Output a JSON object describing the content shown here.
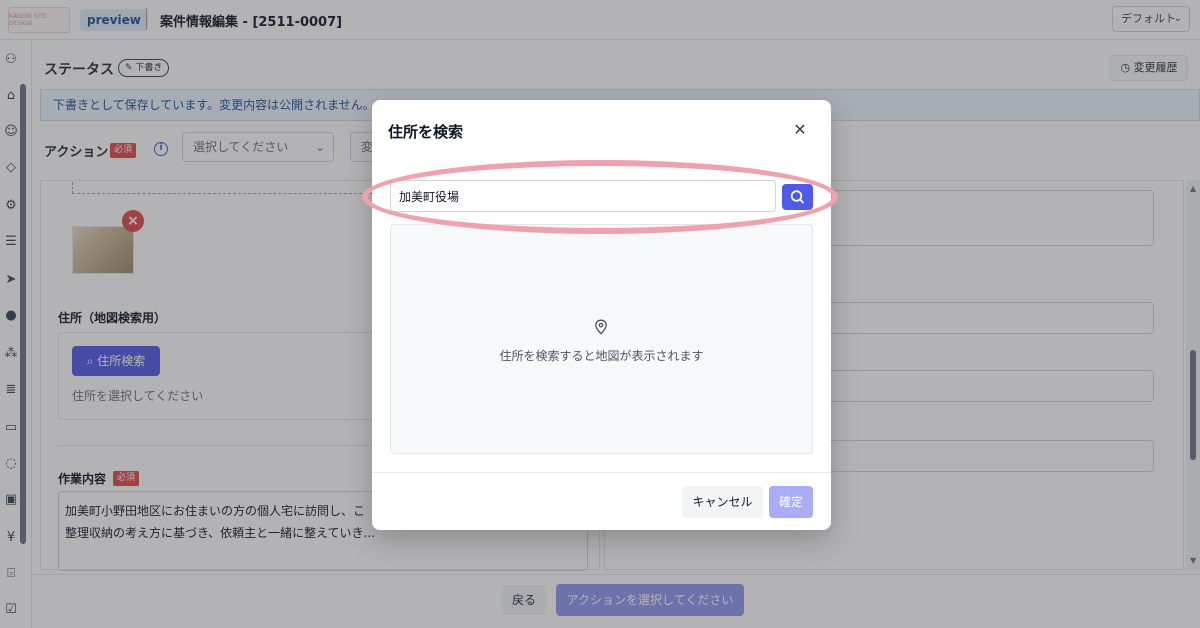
{
  "app": {
    "logo_text": "KAGOKI SITE DESIGN",
    "env_badge": "preview",
    "page_title": "案件情報編集 - [2511-0007]",
    "view_select": "デフォルト"
  },
  "status": {
    "title": "ステータス",
    "draft_label": "下書き",
    "history_button": "変更履歴",
    "notice": "下書きとして保存しています。変更内容は公開されません。"
  },
  "action": {
    "label": "アクション",
    "required": "必須",
    "select_placeholder": "選択してください",
    "select2_partial": "変"
  },
  "address": {
    "label": "住所（地図検索用）",
    "search_button": "住所検索",
    "placeholder": "住所を選択してください"
  },
  "work": {
    "label": "作業内容",
    "required": "必須",
    "line1": "加美町小野田地区にお住まいの方の個人宅に訪問し、こ",
    "line2": "整理収納の考え方に基づき、依頼主と一緒に整えていき..."
  },
  "footer": {
    "back_button": "戻る",
    "primary_button": "アクションを選択してください"
  },
  "modal": {
    "title": "住所を検索",
    "search_value": "加美町役場",
    "map_message": "住所を検索すると地図が表示されます",
    "cancel_button": "キャンセル",
    "confirm_button": "確定"
  },
  "colors": {
    "primary": "#4f5ae6",
    "required_red": "#e0484a",
    "highlight": "#eea2ae"
  },
  "icons": {
    "sidebar": [
      "users-icon",
      "tag-icon",
      "smile-icon",
      "ticket-icon",
      "user-gear-icon",
      "list-icon",
      "send-icon",
      "line-icon",
      "hierarchy-icon",
      "article-icon",
      "document-icon",
      "chat-icon",
      "box-icon",
      "yen-icon",
      "building-icon",
      "check-icon"
    ]
  }
}
